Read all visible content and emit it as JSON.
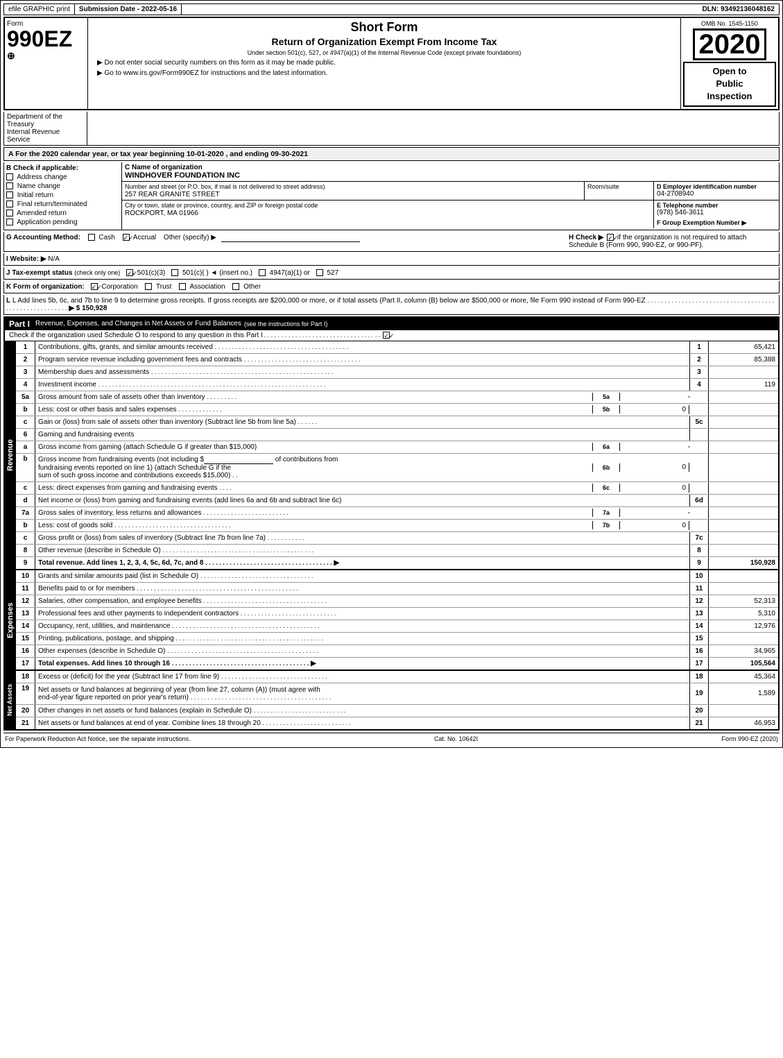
{
  "header": {
    "efile": "efile GRAPHIC print",
    "submission": "Submission Date - 2022-05-16",
    "dln": "DLN: 93492136048162",
    "form_num": "990EZ",
    "form_label": "Form",
    "schedule_label": "⊕",
    "short_form": "Short Form",
    "return_title": "Return of Organization Exempt From Income Tax",
    "under_section": "Under section 501(c), 527, or 4947(a)(1) of the Internal Revenue Code (except private foundations)",
    "no_ssn": "▶ Do not enter social security numbers on this form as it may be made public.",
    "go_to": "▶ Go to www.irs.gov/Form990EZ for instructions and the latest information.",
    "omb": "OMB No. 1545-1150",
    "year": "2020",
    "open_to": "Open to",
    "public": "Public",
    "inspection": "Inspection"
  },
  "tax_year": {
    "line": "A For the 2020 calendar year, or tax year beginning 10-01-2020 , and ending 09-30-2021"
  },
  "check_if": {
    "label": "B Check if applicable:",
    "items": [
      {
        "label": "Address change",
        "checked": false
      },
      {
        "label": "Name change",
        "checked": false
      },
      {
        "label": "Initial return",
        "checked": false
      },
      {
        "label": "Final return/terminated",
        "checked": false
      },
      {
        "label": "Amended return",
        "checked": false
      },
      {
        "label": "Application pending",
        "checked": false
      }
    ]
  },
  "org_info": {
    "c_label": "C Name of organization",
    "org_name": "WINDHOVER FOUNDATION INC",
    "address_label": "Number and street (or P.O. box, if mail is not delivered to street address)",
    "address": "257 REAR GRANITE STREET",
    "room_label": "Room/suite",
    "room": "",
    "city_label": "City or town, state or province, country, and ZIP or foreign postal code",
    "city": "ROCKPORT, MA  01966",
    "d_label": "D Employer identification number",
    "ein": "04-2708940",
    "e_label": "E Telephone number",
    "phone": "(978) 546-3611",
    "f_label": "F Group Exemption Number",
    "f_arrow": "▶"
  },
  "accounting": {
    "g_label": "G Accounting Method:",
    "cash_label": "Cash",
    "cash_checked": false,
    "accrual_label": "Accrual",
    "accrual_checked": true,
    "other_label": "Other (specify) ▶",
    "h_label": "H Check ▶",
    "h_checked": true,
    "h_text": "if the organization is not required to attach Schedule B (Form 990, 990-EZ, or 990-PF)."
  },
  "website": {
    "i_label": "I Website: ▶",
    "url": "N/A"
  },
  "tax_exempt": {
    "j_label": "J Tax-exempt status",
    "j_note": "(check only one)",
    "options": [
      {
        "label": "501(c)(3)",
        "checked": true
      },
      {
        "label": "501(c)(",
        "checked": false
      },
      {
        "label": ") ◄ (insert no.)",
        "checked": false
      },
      {
        "label": "4947(a)(1) or",
        "checked": false
      },
      {
        "label": "527",
        "checked": false
      }
    ]
  },
  "form_org": {
    "k_label": "K Form of organization:",
    "options": [
      {
        "label": "Corporation",
        "checked": true
      },
      {
        "label": "Trust",
        "checked": false
      },
      {
        "label": "Association",
        "checked": false
      },
      {
        "label": "Other",
        "checked": false
      }
    ]
  },
  "gross_receipts": {
    "l_text": "L Add lines 5b, 6c, and 7b to line 9 to determine gross receipts. If gross receipts are $200,000 or more, or if total assets (Part II, column (B) below are $500,000 or more, file Form 990 instead of Form 990-EZ",
    "dots": ". . . . . . . . . . . . . . . . . . . . . . . . . . . . . . . . . . . . . . . . . . . . . . . . . . . . . . . .",
    "arrow": "▶ $",
    "amount": "150,928"
  },
  "part1": {
    "title": "Part I",
    "label": "Revenue, Expenses, and Changes in Net Assets or Fund Balances",
    "note": "(see the instructions for Part I)",
    "check_note": "Check if the organization used Schedule O to respond to any question in this Part I",
    "check_dots": ". . . . . . . . . . . . . . . . . . . . . . . . . . . . . . . . .",
    "check_box": true,
    "rows": [
      {
        "num": "1",
        "sub": "",
        "label": "Contributions, gifts, grants, and similar amounts received",
        "dots": ". . . . . . . . . . . . . . . . . . . . . . . . . . . . . . . . . . . . . . .",
        "ref": "1",
        "amount": "65,421"
      },
      {
        "num": "2",
        "sub": "",
        "label": "Program service revenue including government fees and contracts",
        "dots": ". . . . . . . . . . . . . . . . . . . . . . . . . . . . . . . . . .",
        "ref": "2",
        "amount": "85,388"
      },
      {
        "num": "3",
        "sub": "",
        "label": "Membership dues and assessments",
        "dots": ". . . . . . . . . . . . . . . . . . . . . . . . . . . . . . . . . . . . . . . . . . . . . . . . . . . . .",
        "ref": "3",
        "amount": ""
      },
      {
        "num": "4",
        "sub": "",
        "label": "Investment income",
        "dots": ". . . . . . . . . . . . . . . . . . . . . . . . . . . . . . . . . . . . . . . . . . . . . . . . . . . . . . . . . . . . . . . . . .",
        "ref": "4",
        "amount": "119"
      },
      {
        "num": "5a",
        "sub": "",
        "label": "Gross amount from sale of assets other than inventory",
        "dots": ". . . . . . . . .",
        "ref_col": "5a",
        "col_val": "",
        "ref": "",
        "amount": ""
      },
      {
        "num": "5b",
        "sub": "",
        "label": "Less: cost or other basis and sales expenses",
        "dots": ". . . . . . . . . . . . .",
        "ref_col": "5b",
        "col_val": "0",
        "ref": "",
        "amount": ""
      },
      {
        "num": "5c",
        "sub": "",
        "label": "Gain or (loss) from sale of assets other than inventory (Subtract line 5b from line 5a)",
        "dots": ". . . . . .",
        "ref": "5c",
        "amount": ""
      },
      {
        "num": "6",
        "sub": "",
        "label": "Gaming and fundraising events",
        "dots": "",
        "ref": "",
        "amount": ""
      },
      {
        "num": "6a",
        "sub": "a",
        "label": "Gross income from gaming (attach Schedule G if greater than $15,000)",
        "dots": "",
        "ref_col": "6a",
        "col_val": "",
        "ref": "",
        "amount": ""
      },
      {
        "num": "6b",
        "sub": "b",
        "label": "Gross income from fundraising events (not including $_____ of contributions from fundraising events reported on line 1) (attach Schedule G if the sum of such gross income and contributions exceeds $15,000)",
        "dots": ".",
        "ref_col": "6b",
        "col_val": "0",
        "ref": "",
        "amount": ""
      },
      {
        "num": "6c",
        "sub": "c",
        "label": "Less: direct expenses from gaming and fundraising events",
        "dots": ". . . .",
        "ref_col": "6c",
        "col_val": "0",
        "ref": "",
        "amount": ""
      },
      {
        "num": "6d",
        "sub": "d",
        "label": "Net income or (loss) from gaming and fundraising events (add lines 6a and 6b and subtract line 6c)",
        "dots": "",
        "ref": "6d",
        "amount": ""
      },
      {
        "num": "7a",
        "sub": "a",
        "label": "Gross sales of inventory, less returns and allowances",
        "dots": ". . . . . . . . . . . . . . . . . . . . . . . . .",
        "ref_col": "7a",
        "col_val": "",
        "ref": "",
        "amount": ""
      },
      {
        "num": "7b",
        "sub": "b",
        "label": "Less: cost of goods sold",
        "dots": ". . . . . . . . . . . . . . . . . . . . . . . . . . . . . . . . . . .",
        "ref_col": "7b",
        "col_val": "0",
        "ref": "",
        "amount": ""
      },
      {
        "num": "7c",
        "sub": "c",
        "label": "Gross profit or (loss) from sales of inventory (Subtract line 7b from line 7a)",
        "dots": ". . . . . . . . . . .",
        "ref": "7c",
        "amount": ""
      },
      {
        "num": "8",
        "sub": "",
        "label": "Other revenue (describe in Schedule O)",
        "dots": ". . . . . . . . . . . . . . . . . . . . . . . . . . . . . . . . . . . . . . . . . . . . .",
        "ref": "8",
        "amount": ""
      },
      {
        "num": "9",
        "sub": "",
        "label": "Total revenue. Add lines 1, 2, 3, 4, 5c, 6d, 7c, and 8",
        "dots": ". . . . . . . . . . . . . . . . . . . . . . . . . . . . . . . . . . . . . .",
        "arrow": "▶",
        "ref": "9",
        "amount": "150,928",
        "bold": true
      }
    ]
  },
  "expenses": {
    "rows": [
      {
        "num": "10",
        "label": "Grants and similar amounts paid (list in Schedule O)",
        "dots": ". . . . . . . . . . . . . . . . . . . . . . . . . . . . . . . . .",
        "ref": "10",
        "amount": ""
      },
      {
        "num": "11",
        "label": "Benefits paid to or for members",
        "dots": ". . . . . . . . . . . . . . . . . . . . . . . . . . . . . . . . . . . . . . . . . . . . . . .",
        "ref": "11",
        "amount": ""
      },
      {
        "num": "12",
        "label": "Salaries, other compensation, and employee benefits",
        "dots": ". . . . . . . . . . . . . . . . . . . . . . . . . . . . . . . . . . . .",
        "ref": "12",
        "amount": "52,313"
      },
      {
        "num": "13",
        "label": "Professional fees and other payments to independent contractors",
        "dots": ". . . . . . . . . . . . . . . . . . . . . . . . . . . .",
        "ref": "13",
        "amount": "5,310"
      },
      {
        "num": "14",
        "label": "Occupancy, rent, utilities, and maintenance",
        "dots": ". . . . . . . . . . . . . . . . . . . . . . . . . . . . . . . . . . . . . . . . . . .",
        "ref": "14",
        "amount": "12,976"
      },
      {
        "num": "15",
        "label": "Printing, publications, postage, and shipping",
        "dots": ". . . . . . . . . . . . . . . . . . . . . . . . . . . . . . . . . . . . . . . . . . .",
        "ref": "15",
        "amount": ""
      },
      {
        "num": "16",
        "label": "Other expenses (describe in Schedule O)",
        "dots": ". . . . . . . . . . . . . . . . . . . . . . . . . . . . . . . . . . . . . . . . . . . .",
        "ref": "16",
        "amount": "34,965"
      },
      {
        "num": "17",
        "label": "Total expenses. Add lines 10 through 16",
        "dots": ". . . . . . . . . . . . . . . . . . . . . . . . . . . . . . . . . . . . . . . . .",
        "arrow": "▶",
        "ref": "17",
        "amount": "105,564",
        "bold": true
      }
    ]
  },
  "net_assets": {
    "rows": [
      {
        "num": "18",
        "label": "Excess or (deficit) for the year (Subtract line 17 from line 9)",
        "dots": ". . . . . . . . . . . . . . . . . . . . . . . . . . . . . . .",
        "ref": "18",
        "amount": "45,364"
      },
      {
        "num": "19",
        "label": "Net assets or fund balances at beginning of year (from line 27, column (A)) (must agree with end-of-year figure reported on prior year's return)",
        "dots": ". . . . . . . . . . . . . . . . . . . . . . . . . . . . . . . . . . . . . . . . .",
        "ref": "19",
        "amount": "1,589"
      },
      {
        "num": "20",
        "label": "Other changes in net assets or fund balances (explain in Schedule O)",
        "dots": ". . . . . . . . . . . . . . . . . . . . . . . . . . .",
        "ref": "20",
        "amount": ""
      },
      {
        "num": "21",
        "label": "Net assets or fund balances at end of year. Combine lines 18 through 20",
        "dots": ". . . . . . . . . . . . . . . . . . . . . . . . . .",
        "ref": "21",
        "amount": "46,953"
      }
    ]
  },
  "footer": {
    "paperwork": "For Paperwork Reduction Act Notice, see the separate instructions.",
    "cat": "Cat. No. 10642I",
    "form_label": "Form 990-EZ (2020)"
  }
}
